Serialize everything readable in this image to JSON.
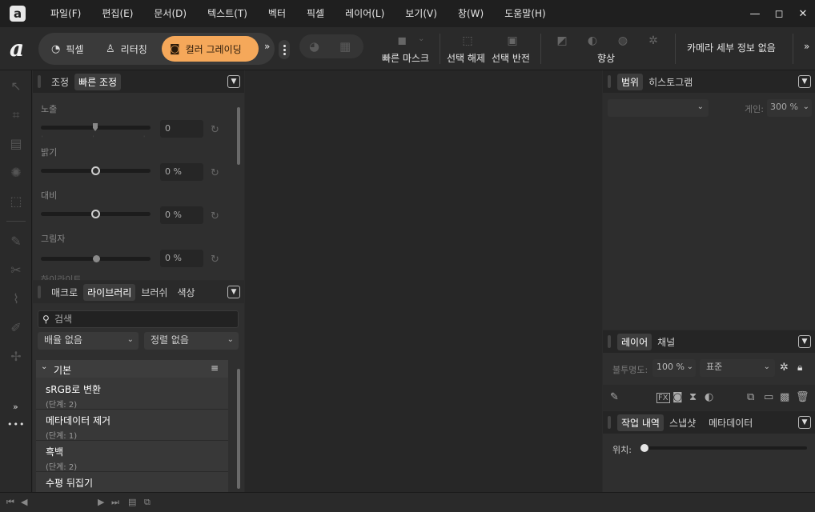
{
  "menu": [
    "파일(F)",
    "편집(E)",
    "문서(D)",
    "텍스트(T)",
    "벡터",
    "픽셀",
    "레이어(L)",
    "보기(V)",
    "창(W)",
    "도움말(H)"
  ],
  "window": {
    "minimize": "—",
    "restore": "◻",
    "close": "✕"
  },
  "personas": [
    {
      "label": "픽셀",
      "icon": "◔"
    },
    {
      "label": "리터칭",
      "icon": "♙"
    },
    {
      "label": "컬러 그레이딩",
      "icon": "◙"
    }
  ],
  "toolbar": {
    "more": "»",
    "quick_mask": "빠른 마스크",
    "deselect": "선택 해제",
    "invert": "선택 반전",
    "enhance": "향상",
    "camera_info": "카메라 세부 정보 없음",
    "overflow": "»"
  },
  "adjust_panel": {
    "tabs": [
      "조정",
      "빠른 조정"
    ],
    "sliders": [
      {
        "label": "노출",
        "value": "0",
        "pos": 0.5
      },
      {
        "label": "밝기",
        "value": "0 %",
        "pos": 0.5
      },
      {
        "label": "대비",
        "value": "0 %",
        "pos": 0.5
      },
      {
        "label": "그림자",
        "value": "0 %",
        "pos": 0.5
      }
    ],
    "cut_label": "하이라이트"
  },
  "library_panel": {
    "tabs": [
      "매크로",
      "라이브러리",
      "브러쉬",
      "색상"
    ],
    "search_placeholder": "검색",
    "sort_a": "배율 없음",
    "sort_b": "정렬 없음",
    "group": "기본",
    "items": [
      {
        "title": "sRGB로 변환",
        "sub": "(단계: 2)"
      },
      {
        "title": "메타데이터 제거",
        "sub": "(단계: 1)"
      },
      {
        "title": "흑백",
        "sub": "(단계: 2)"
      },
      {
        "title": "수평 뒤집기",
        "sub": ""
      }
    ]
  },
  "histogram_panel": {
    "tabs": [
      "범위",
      "히스토그램"
    ],
    "gain_label": "게인:",
    "gain_value": "300 %"
  },
  "layers_panel": {
    "tabs": [
      "레이어",
      "채널"
    ],
    "opacity_label": "불투명도:",
    "opacity_value": "100 %",
    "blend": "표준"
  },
  "history_panel": {
    "tabs": [
      "작업 내역",
      "스냅샷",
      "메타데이터"
    ],
    "position_label": "위치:"
  },
  "left_more": "»",
  "left_dots": "•••"
}
